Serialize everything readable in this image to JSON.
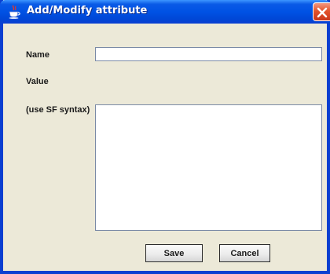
{
  "window": {
    "title": "Add/Modify attribute",
    "icon": "java-coffee-cup-icon",
    "close_icon": "close-x-icon"
  },
  "form": {
    "name_label": "Name",
    "name_value": "",
    "value_label": "Value",
    "syntax_label": "(use SF syntax)",
    "value_text": ""
  },
  "buttons": {
    "save_label": "Save",
    "cancel_label": "Cancel"
  },
  "colors": {
    "titlebar": "#0052e4",
    "window_frame": "#0a3fd1",
    "dialog_background": "#ece9d8",
    "close_button": "#e3532c"
  }
}
